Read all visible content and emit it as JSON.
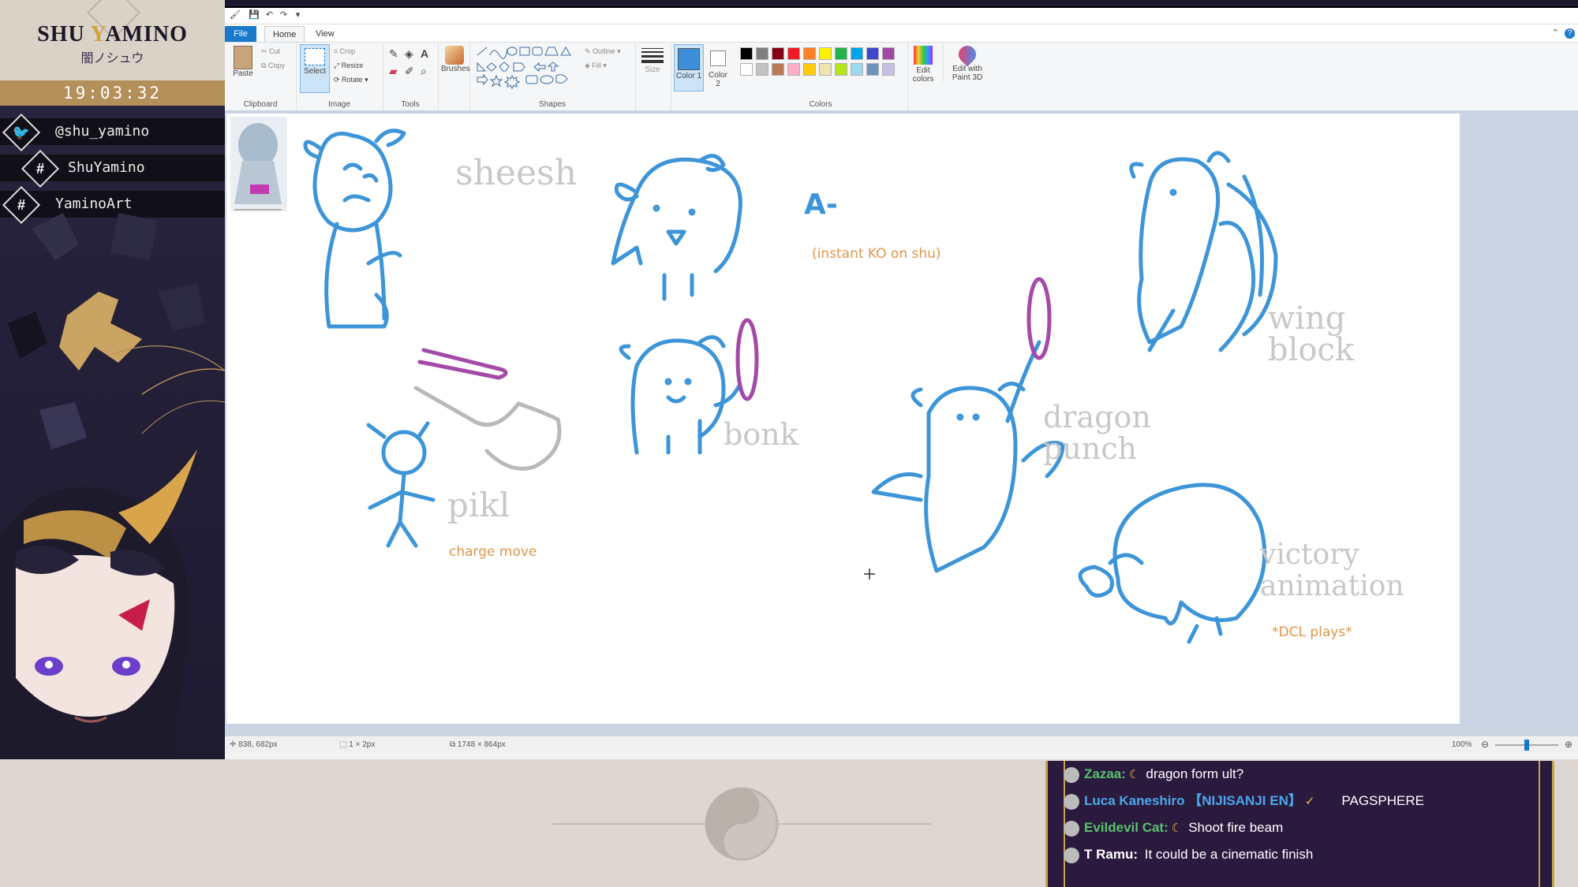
{
  "overlay": {
    "brand_name_a": "SHU ",
    "brand_name_y": "Y",
    "brand_name_b": "AMINO",
    "brand_sub": "闇ノシュウ",
    "clock": "19:03:32",
    "socials": [
      {
        "icon": "twitter-icon",
        "text": "@shu_yamino"
      },
      {
        "icon": "hashtag-icon",
        "text": "ShuYamino"
      },
      {
        "icon": "hashtag-icon",
        "text": "YaminoArt"
      }
    ]
  },
  "paint": {
    "tabs": [
      "File",
      "Home",
      "View"
    ],
    "clipboard": {
      "paste": "Paste",
      "cut": "Cut",
      "copy": "Copy",
      "label": "Clipboard"
    },
    "image": {
      "select": "Select",
      "crop": "Crop",
      "resize": "Resize",
      "rotate": "Rotate",
      "label": "Image"
    },
    "tools": {
      "label": "Tools",
      "brushes": "Brushes"
    },
    "shapes": {
      "outline": "Outline",
      "fill": "Fill",
      "label": "Shapes"
    },
    "size": "Size",
    "color1": "Color 1",
    "color2": "Color 2",
    "colors_label": "Colors",
    "edit_colors": "Edit colors",
    "edit_paint3d": "Edit with Paint 3D",
    "palette": [
      "#000000",
      "#7f7f7f",
      "#880015",
      "#ed1c24",
      "#ff7f27",
      "#fff200",
      "#22b14c",
      "#00a2e8",
      "#3f48cc",
      "#a349a4",
      "#ffffff",
      "#c3c3c3",
      "#b97a57",
      "#ffaec9",
      "#ffc90e",
      "#efe4b0",
      "#b5e61d",
      "#99d9ea",
      "#7092be",
      "#c8bfe7"
    ],
    "canvas": {
      "sketch_labels": [
        {
          "id": "sheesh",
          "text": "sheesh"
        },
        {
          "id": "a-minus",
          "text": "A-"
        },
        {
          "id": "wing-block",
          "text": "wing block"
        },
        {
          "id": "bonk",
          "text": "bonk"
        },
        {
          "id": "dragon-punch",
          "text": "dragon punch"
        },
        {
          "id": "pikl",
          "text": "pikl"
        },
        {
          "id": "victory",
          "text": "victory animation"
        }
      ],
      "notes": {
        "instant_ko": "(instant KO on shu)",
        "charge_move": "charge move",
        "dcl": "*DCL plays*"
      }
    },
    "status": {
      "cursor": "838, 682px",
      "selection": "1 × 2px",
      "size": "1748 × 864px",
      "zoom": "100%"
    }
  },
  "chat": [
    {
      "user": "Zazaa:",
      "color": "#57c26a",
      "badge": "moon",
      "text": "dragon form ult?"
    },
    {
      "user": "Luca Kaneshiro 【NIJISANJI EN】",
      "color": "#4aa8e8",
      "badge": "verified",
      "text": "PAGSPHERE"
    },
    {
      "user": "Evildevil Cat:",
      "color": "#57c26a",
      "badge": "moon",
      "text": "Shoot fire beam"
    },
    {
      "user": "T Ramu:",
      "color": "#ffffff",
      "badge": "",
      "text": "It could be a cinematic finish"
    }
  ]
}
